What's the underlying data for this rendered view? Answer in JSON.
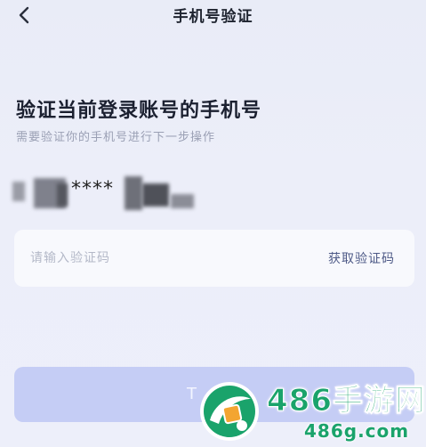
{
  "header": {
    "title": "手机号验证",
    "back_icon": "chevron-left-icon"
  },
  "main": {
    "heading": "验证当前登录账号的手机号",
    "subheading": "需要验证你的手机号进行下一步操作",
    "phone_masked": "****"
  },
  "code_field": {
    "placeholder": "请输入验证码",
    "value": "",
    "get_code_label": "获取验证码"
  },
  "submit": {
    "label": "T"
  },
  "watermark": {
    "name": "486手游网",
    "domain": "486g.com"
  },
  "colors": {
    "background": "#eceef9",
    "card": "#f8f9fd",
    "button": "#c5cdf5",
    "link": "#4e5a87",
    "watermark_green": "#1aa36b"
  }
}
